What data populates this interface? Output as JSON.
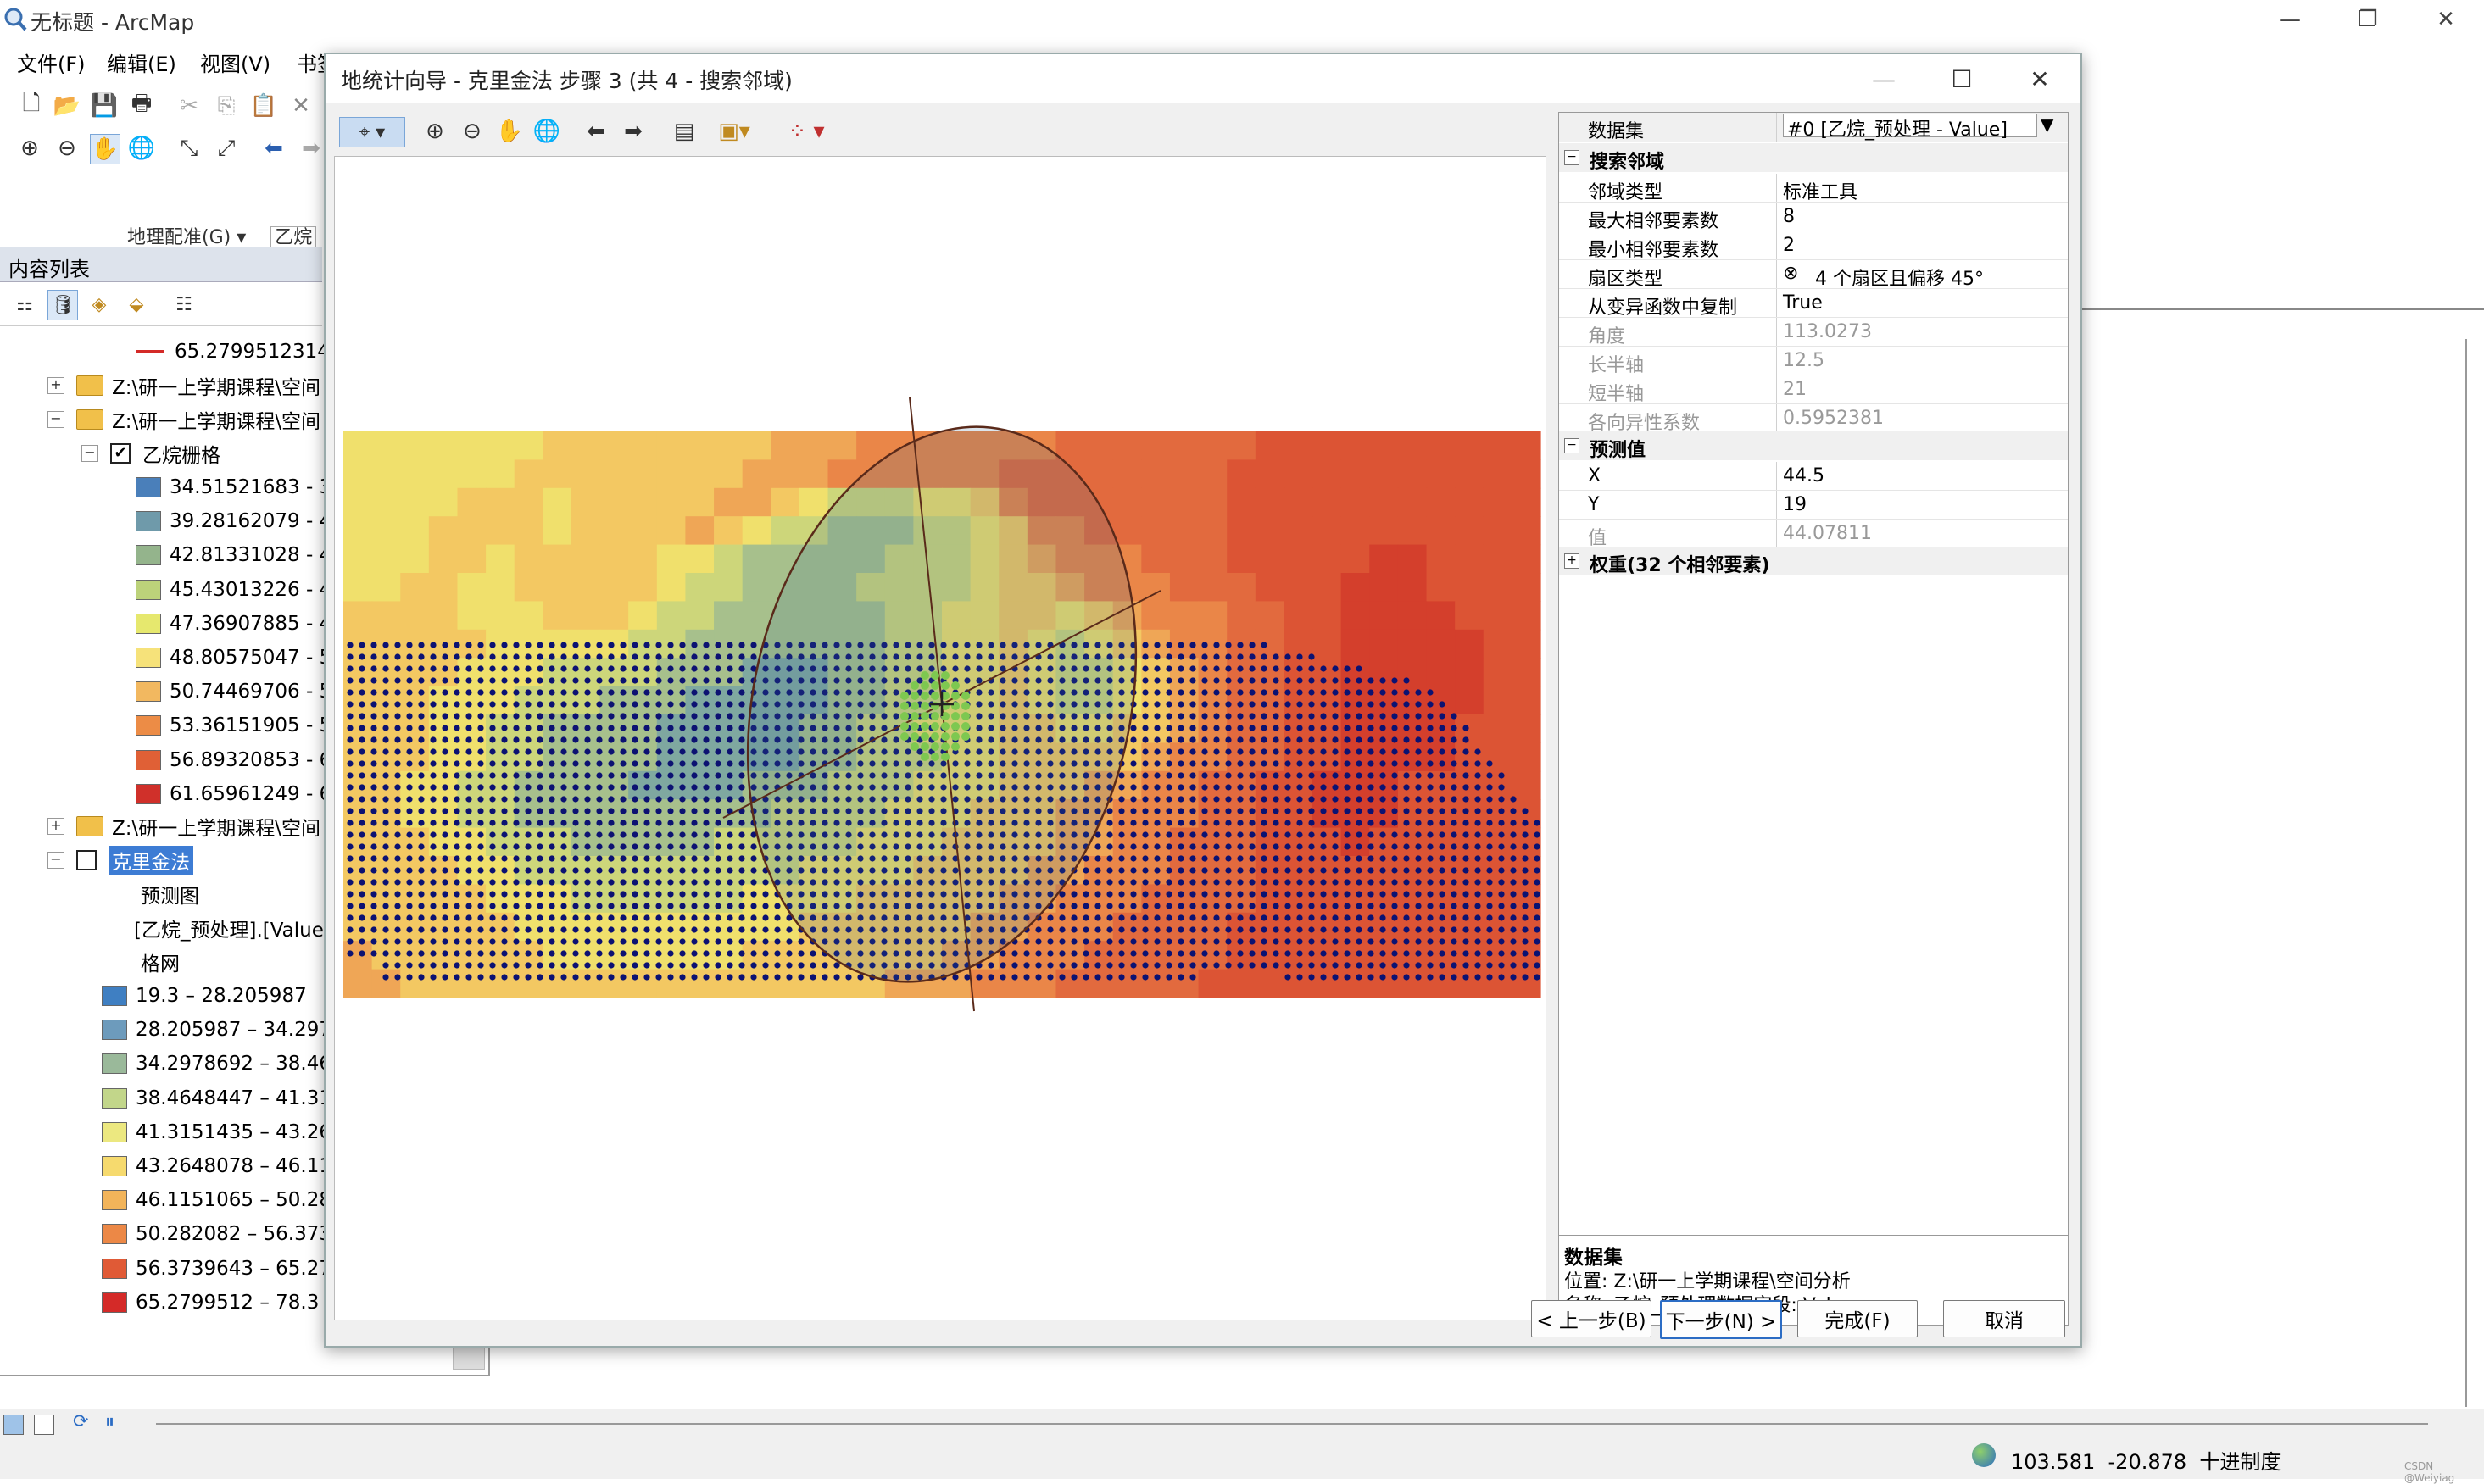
{
  "app": {
    "title": "无标题 - ArcMap"
  },
  "menu": [
    "文件(F)",
    "编辑(E)",
    "视图(V)",
    "书签"
  ],
  "toolbar_strip": {
    "georef_label": "地理配准(G) ▾",
    "layer_label": "乙烷"
  },
  "toc": {
    "title": "内容列表",
    "top_legend_value": "65.2799512314",
    "group1_path": "Z:\\研一上学期课程\\空间",
    "group2_path": "Z:\\研一上学期课程\\空间",
    "raster_layer": "乙烷栅格",
    "raster_classes": [
      {
        "label": "34.51521683 - 3",
        "color": "#4a7fba"
      },
      {
        "label": "39.28162079 - 4",
        "color": "#6f9aaa"
      },
      {
        "label": "42.81331028 - 4",
        "color": "#94b48c"
      },
      {
        "label": "45.43013226 - 4",
        "color": "#bcd27a"
      },
      {
        "label": "47.36907885 - 4",
        "color": "#e6e86e"
      },
      {
        "label": "48.80575047 - 5",
        "color": "#f6e27a"
      },
      {
        "label": "50.74469706 - 5",
        "color": "#f2b860"
      },
      {
        "label": "53.36151905 - 5",
        "color": "#ec8c46"
      },
      {
        "label": "56.89320853 - 6",
        "color": "#e06036"
      },
      {
        "label": "61.65961249 - 6",
        "color": "#d0302a"
      }
    ],
    "group3_path": "Z:\\研一上学期课程\\空间",
    "kriging_layer": "克里金法",
    "prediction_label": "预测图",
    "field_label": "[乙烷_预处理].[Value",
    "grid_label": "格网",
    "kriging_classes": [
      {
        "label": "19.3 – 28.205987",
        "color": "#3f7fc2"
      },
      {
        "label": "28.205987 – 34.297",
        "color": "#6d9bbc"
      },
      {
        "label": "34.2978692 – 38.46",
        "color": "#9ab99a"
      },
      {
        "label": "38.4648447 – 41.31",
        "color": "#c2d68a"
      },
      {
        "label": "41.3151435 – 43.26",
        "color": "#ece880"
      },
      {
        "label": "43.2648078 – 46.11",
        "color": "#f6da6e"
      },
      {
        "label": "46.1151065 – 50.28",
        "color": "#f2b45a"
      },
      {
        "label": "50.282082 – 56.373",
        "color": "#ec8846"
      },
      {
        "label": "56.3739643 – 65.27",
        "color": "#e05a36"
      },
      {
        "label": "65.2799512 – 78.3",
        "color": "#d42a28"
      }
    ]
  },
  "dialog": {
    "title": "地统计向导 - 克里金法 步骤 3 (共 4 - 搜索邻域)",
    "dataset_label": "数据集",
    "dataset_value": "#0 [乙烷_预处理 - Value]",
    "search_group": "搜索邻域",
    "props": [
      {
        "k": "邻域类型",
        "v": "标准工具",
        "gray": false
      },
      {
        "k": "最大相邻要素数",
        "v": "8",
        "gray": false
      },
      {
        "k": "最小相邻要素数",
        "v": "2",
        "gray": false
      },
      {
        "k": "扇区类型",
        "v": "4 个扇区且偏移 45°",
        "gray": false
      },
      {
        "k": "从变异函数中复制",
        "v": "True",
        "gray": false
      },
      {
        "k": "角度",
        "v": "113.0273",
        "gray": true
      },
      {
        "k": "长半轴",
        "v": "12.5",
        "gray": true
      },
      {
        "k": "短半轴",
        "v": "21",
        "gray": true
      },
      {
        "k": "各向异性系数",
        "v": "0.5952381",
        "gray": true
      }
    ],
    "predict_group": "预测值",
    "predict": [
      {
        "k": "X",
        "v": "44.5",
        "gray": false
      },
      {
        "k": "Y",
        "v": "19",
        "gray": false
      },
      {
        "k": "值",
        "v": "44.07811",
        "gray": true
      }
    ],
    "weights_group": "权重(32 个相邻要素)",
    "info": {
      "title": "数据集",
      "location": "位置: Z:\\研一上学期课程\\空间分析",
      "name": "名称: 乙烷_预处理数据字段: Value"
    },
    "buttons": {
      "back": "< 上一步(B)",
      "next": "下一步(N) >",
      "finish": "完成(F)",
      "cancel": "取消"
    }
  },
  "status": {
    "coord_x": "103.581",
    "coord_y": "-20.878",
    "units": "十进制度",
    "watermark": "CSDN @Weiyiag"
  },
  "heatmap": {
    "rows": 20,
    "cols": 42,
    "values": [
      "DDDDDDDEEEEEEEEFFFGGGGGGGHHHHHHHIIIIIIIIII",
      "DDDDDDEEEEEEEEFFFGGGGGGHHHHHHHHIIIIIIIIIII",
      "DDDDEEEDEEEEEFFEDCCCDDEGHHHHHHHIIIIIIIIIII",
      "DDDEEEEDEEEEFEDCCBBBCCDEGGHHHHHIIIIIIIIIII",
      "DDDEEDEEEEEDDCBBBBBCCCDEFGGGHHHIIIIIJJIIII",
      "DDEEDDEEEEEDCCBBBBCCCCDEEFGGGHHHIIIJJJIIII",
      "EEEEDDDEEEDCCBBBBBBCCDDEEDEFGGGHHIIJJJJIII",
      "EEEEEDDDDDCCBBBBBBBCCDDEDCDEFGGHHIIJJJJJII",
      "EEEEDDDCCCCBBBAAABBCCDDEDCCDEFGHHIIJJJJJII",
      "EEEDDDCCCBBBAAAAABBCCDDEDCCDEFGHHIIJJJJJII",
      "EEEDDCCBBBBAAAAABBCCDDDEEDDEEFGHHIIJJJJIII",
      "EEEDDCCBBBBAAAAABBCCCDDEEEEEFGGHHIIJJJJIII",
      "EEDDCCBBBBAAAABBBCCCDDDEEEFFGGHHIIJJJIIIII",
      "EEDDCCBBBBBBBBBCCCCDDDEEEFFGGGHHIIJJJIIIII",
      "EEEDDCCCBBBBBCCCCCDDDEEEEFFGGHHHIIIJIIIIII",
      "EEEEDDCCCCCCCCCCDDDDEEEEFFGGGHHHIIIIIIIIII",
      "EEEEEDDDCCCCCCDDDDEEEEEFFGGGHHHHIIIIIIIIII",
      "EEEEEEDDDDDDDDDDEEEEEEFFGGGHHHHIIIIIIIIIII",
      "FEEEEEEDDDDDDDEEEEEEEFFGGGHHHHHIIIIIIIIIII",
      "FFEEEEEEEEEEEEEEEEEFFFGGGHHHHHIIIIIIIIIIII"
    ],
    "palette": {
      "A": "#7fa8a0",
      "B": "#a7c08c",
      "C": "#cdd67a",
      "D": "#f0e06c",
      "E": "#f3c862",
      "F": "#efa656",
      "G": "#ea8648",
      "H": "#e26a3e",
      "I": "#dc5434",
      "J": "#d43f2c"
    }
  },
  "colors": {
    "dot": "#0c1272",
    "selected": "#3d7cd4",
    "ellipse": "#5a2a1a",
    "neighbor": "#7ec850"
  }
}
